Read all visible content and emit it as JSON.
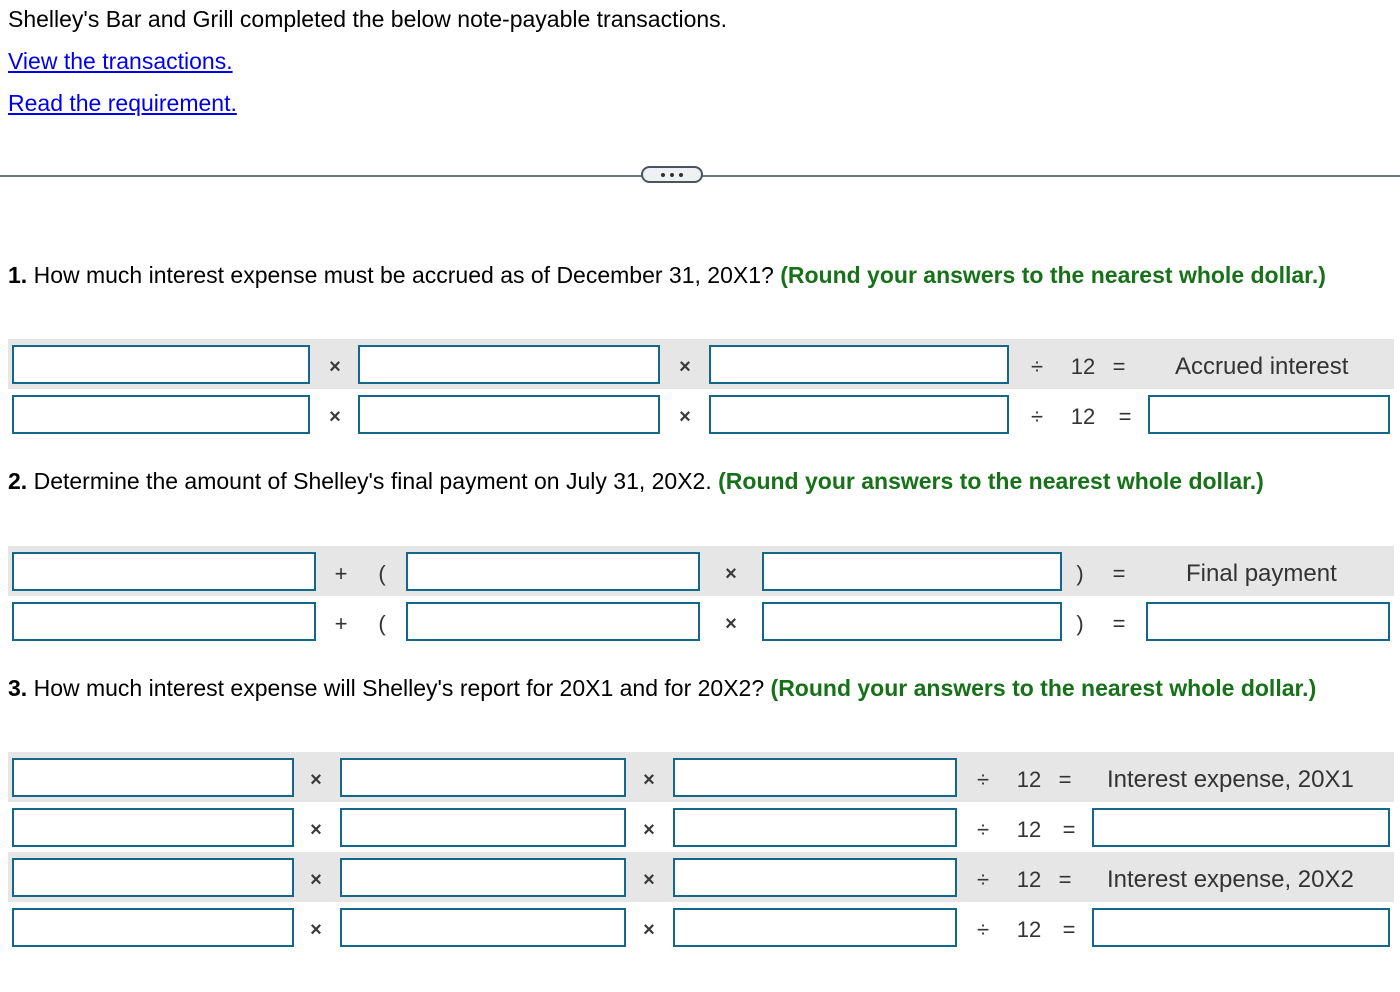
{
  "intro": "Shelley's Bar and Grill completed the below note-payable transactions.",
  "links": {
    "view_transactions": "View the transactions.",
    "read_requirement": "Read the requirement."
  },
  "separator": {
    "icon": "ellipsis-icon"
  },
  "operators": {
    "times": "×",
    "divide": "÷",
    "twelve": "12",
    "equals": "=",
    "plus": "+",
    "lparen": "(",
    "rparen": ")"
  },
  "q1": {
    "number": "1.",
    "text": " How much interest expense must be accrued as of December 31, 20X1? ",
    "hint": "(Round your answers to the nearest whole dollar.)",
    "header_label": "Accrued interest",
    "inputs": {
      "principal": "",
      "rate": "",
      "months": "",
      "result": ""
    }
  },
  "q2": {
    "number": "2.",
    "text": " Determine the amount of Shelley's final payment on July 31, 20X2. ",
    "hint": "(Round your answers to the nearest whole dollar.)",
    "header_label": "Final payment",
    "inputs": {
      "principal": "",
      "term1": "",
      "term2": "",
      "result": ""
    }
  },
  "q3": {
    "number": "3.",
    "text": " How much interest expense will Shelley's report for 20X1 and for 20X2? ",
    "hint": "(Round your answers to the nearest whole dollar.)",
    "header_label_20x1": "Interest expense, 20X1",
    "header_label_20x2": "Interest expense, 20X2",
    "inputs_20x1": {
      "principal": "",
      "rate": "",
      "months": "",
      "result": ""
    },
    "inputs_20x2": {
      "principal": "",
      "rate": "",
      "months": "",
      "result": ""
    }
  }
}
